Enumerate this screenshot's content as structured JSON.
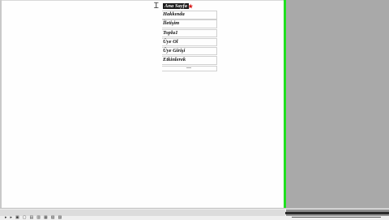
{
  "page": {
    "canvas_color": "#fefefe",
    "guide_color": "#1fe01f",
    "panel_color": "#a9a9a9"
  },
  "cursor": {
    "icon": "text-cursor-icon",
    "glyph": "Ɪ"
  },
  "menu": {
    "items": [
      {
        "label": "Ana Sayfa"
      },
      {
        "label": "Hakkında"
      },
      {
        "label": "İletişim"
      },
      {
        "label": "Toplu1"
      },
      {
        "label": "Üye Ol"
      },
      {
        "label": "Üye Girişi"
      },
      {
        "label": "Etkinlerek"
      }
    ],
    "star_glyph": "★",
    "star_color": "#d81b1b"
  },
  "statusbar": {
    "tools": [
      "▸",
      "▸",
      "▣",
      "▢",
      "▤",
      "▥",
      "▦",
      "▧",
      "▨"
    ]
  }
}
